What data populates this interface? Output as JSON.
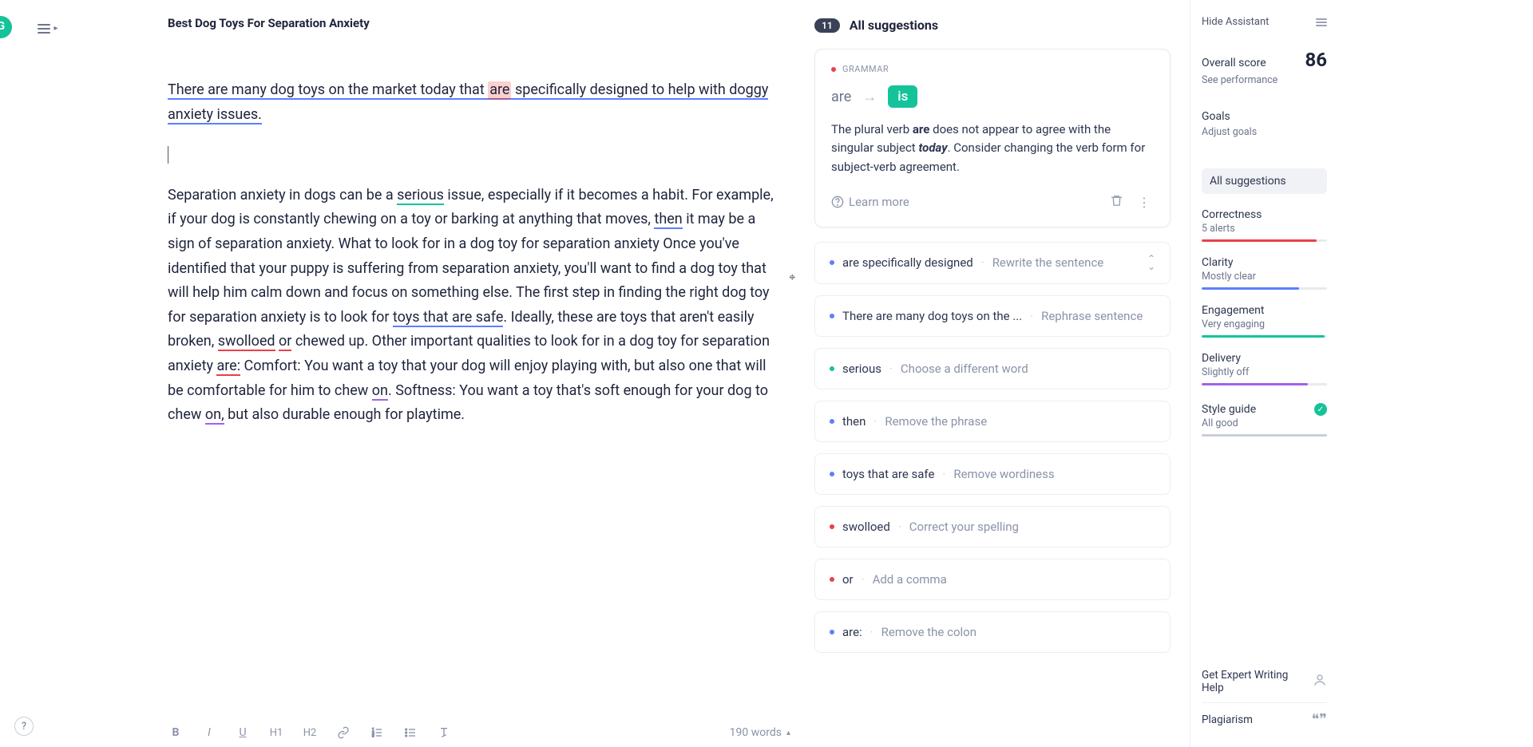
{
  "header": {
    "doc_title": "Best Dog Toys For Separation Anxiety"
  },
  "content": {
    "p1_a": "There are many dog toys on the market today that ",
    "p1_hl": "are",
    "p1_b": " specifically ",
    "p1_c": "designed",
    "p1_d": " to help with doggy anxiety issues.",
    "p2_a": "Separation anxiety in dogs can be a ",
    "p2_serious": "serious",
    "p2_b": " issue, especially if it becomes a habit. For example, if your dog is constantly chewing on a toy or barking at anything that moves, ",
    "p2_then": "then",
    "p2_c": " it may be a sign of separation anxiety. What to look for in a dog toy for separation anxiety Once you've identified that your puppy is suffering from separation anxiety, you'll want to find a dog toy that will help him calm down and focus on something else. The first step in finding the right dog toy for separation anxiety is to look for ",
    "p2_safe": "toys that are safe",
    "p2_d": ". Ideally, these are toys that aren't easily broken, ",
    "p2_swolloed": "swolloed",
    "p2_e": " ",
    "p2_or": "or",
    "p2_f": " chewed up. Other important qualities to look for in a dog toy for separation anxiety ",
    "p2_are": "are:",
    "p2_g": " Comfort: You want a toy that your dog will enjoy playing with, but also one that will be comfortable for him to chew ",
    "p2_on1": "on",
    "p2_h": ". Softness: You want a toy that's soft enough for your dog to chew ",
    "p2_on2": "on,",
    "p2_i": " but also durable enough for playtime."
  },
  "footer": {
    "word_count": "190 words"
  },
  "suggestions": {
    "count": "11",
    "title": "All suggestions",
    "card": {
      "category": "GRAMMAR",
      "wrong": "are",
      "fix": "is",
      "explain_a": "The plural verb ",
      "explain_b": "are",
      "explain_c": " does not appear to agree with the singular subject ",
      "explain_d": "today",
      "explain_e": ". Consider changing the verb form for subject-verb agreement.",
      "learn": "Learn more"
    },
    "items": [
      {
        "color": "blue",
        "text": "are specifically designed",
        "hint": "Rewrite the sentence",
        "expand": true
      },
      {
        "color": "blue",
        "text": "There are many dog toys on the ...",
        "hint": "Rephrase sentence"
      },
      {
        "color": "green",
        "text": "serious",
        "hint": "Choose a different word"
      },
      {
        "color": "blue",
        "text": "then",
        "hint": "Remove the phrase"
      },
      {
        "color": "blue",
        "text": "toys that are safe",
        "hint": "Remove wordiness"
      },
      {
        "color": "red",
        "text": "swolloed",
        "hint": "Correct your spelling"
      },
      {
        "color": "red",
        "text": "or",
        "hint": "Add a comma"
      },
      {
        "color": "blue",
        "text": "are:",
        "hint": "Remove the colon"
      }
    ]
  },
  "sidebar": {
    "hide": "Hide Assistant",
    "score_label": "Overall score",
    "score": "86",
    "see_perf": "See performance",
    "goals_label": "Goals",
    "goals_sub": "Adjust goals",
    "all_sugg": "All suggestions",
    "metrics": [
      {
        "title": "Correctness",
        "sub": "5 alerts",
        "color": "red",
        "w": "92%"
      },
      {
        "title": "Clarity",
        "sub": "Mostly clear",
        "color": "blue",
        "w": "78%"
      },
      {
        "title": "Engagement",
        "sub": "Very engaging",
        "color": "green",
        "w": "98%"
      },
      {
        "title": "Delivery",
        "sub": "Slightly off",
        "color": "purple",
        "w": "85%"
      }
    ],
    "style_title": "Style guide",
    "style_sub": "All good",
    "expert": "Get Expert Writing Help",
    "plag": "Plagiarism"
  }
}
